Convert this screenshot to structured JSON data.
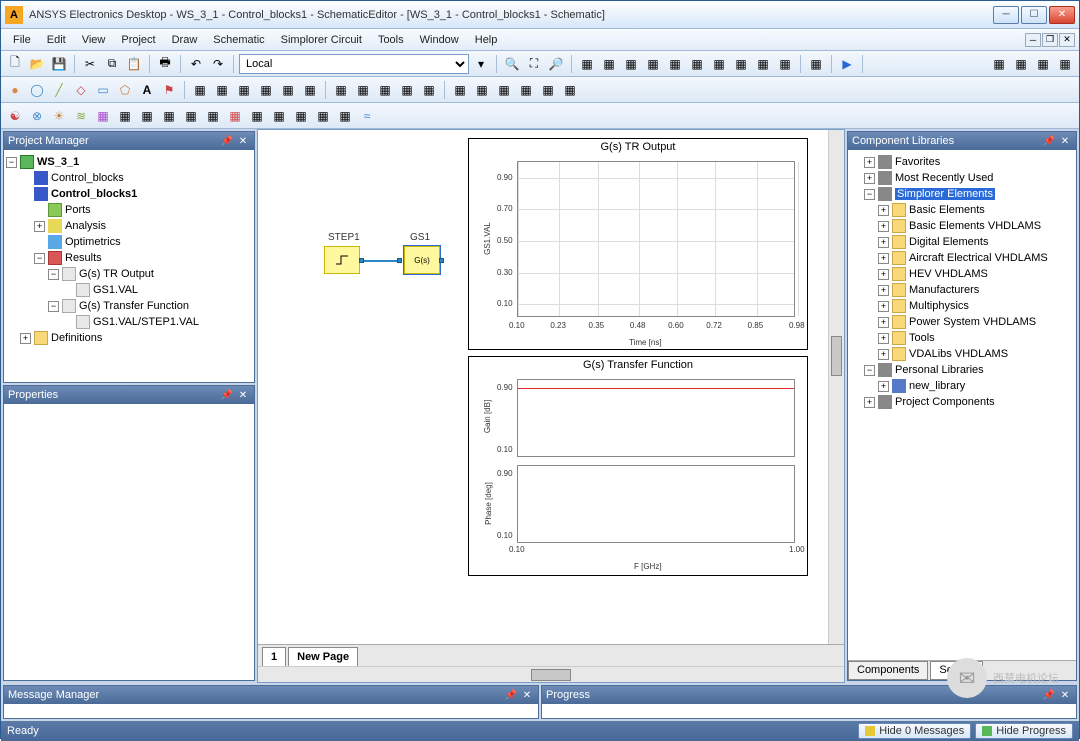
{
  "title": "ANSYS Electronics Desktop - WS_3_1 - Control_blocks1 - SchematicEditor - [WS_3_1 - Control_blocks1 - Schematic]",
  "menu": [
    "File",
    "Edit",
    "View",
    "Project",
    "Draw",
    "Schematic",
    "Simplorer Circuit",
    "Tools",
    "Window",
    "Help"
  ],
  "toolbar1": {
    "combo": "Local"
  },
  "panels": {
    "projectManager": "Project Manager",
    "properties": "Properties",
    "componentLibraries": "Component Libraries",
    "messageManager": "Message Manager",
    "progress": "Progress"
  },
  "tree": {
    "root": "WS_3_1",
    "items": [
      {
        "label": "Control_blocks",
        "icon": "i-blk"
      },
      {
        "label": "Control_blocks1",
        "icon": "i-blk",
        "bold": true
      },
      {
        "label": "Ports",
        "icon": "i-port",
        "indent": 2
      },
      {
        "label": "Analysis",
        "icon": "i-ana",
        "indent": 2,
        "exp": "+"
      },
      {
        "label": "Optimetrics",
        "icon": "i-opt",
        "indent": 2
      },
      {
        "label": "Results",
        "icon": "i-res",
        "indent": 2,
        "exp": "-"
      },
      {
        "label": "G(s) TR Output",
        "icon": "i-chart",
        "indent": 3,
        "exp": "-"
      },
      {
        "label": "GS1.VAL",
        "icon": "i-chart",
        "indent": 4
      },
      {
        "label": "G(s) Transfer Function",
        "icon": "i-chart",
        "indent": 3,
        "exp": "-"
      },
      {
        "label": "GS1.VAL/STEP1.VAL",
        "icon": "i-chart",
        "indent": 4
      },
      {
        "label": "Definitions",
        "icon": "i-def",
        "indent": 1,
        "exp": "+"
      }
    ]
  },
  "schematic": {
    "blocks": [
      {
        "name": "STEP1"
      },
      {
        "name": "GS1",
        "text": "G(s)"
      }
    ],
    "tabs": {
      "current": "1",
      "new": "New Page"
    }
  },
  "chart_data": [
    {
      "type": "line",
      "title": "G(s) TR Output",
      "xlabel": "Time [ns]",
      "ylabel": "GS1.VAL",
      "x": [
        0.1,
        0.23,
        0.35,
        0.48,
        0.6,
        0.72,
        0.85,
        0.98
      ],
      "xticks": [
        0.1,
        0.23,
        0.35,
        0.48,
        0.6,
        0.72,
        0.85,
        0.98
      ],
      "yticks": [
        0.1,
        0.3,
        0.5,
        0.7,
        0.9
      ],
      "xlim": [
        0.1,
        0.98
      ],
      "ylim": [
        0.0,
        1.0
      ]
    },
    {
      "type": "line",
      "title": "G(s) Transfer Function",
      "xlabel": "F [GHz]",
      "subplots": [
        {
          "ylabel": "Gain [dB]",
          "yticks": [
            0.1,
            0.9
          ],
          "flatline": 0.9,
          "xlim": [
            0.1,
            1.0
          ]
        },
        {
          "ylabel": "Phase [deg]",
          "yticks": [
            0.1,
            0.9
          ],
          "xlim": [
            0.1,
            1.0
          ]
        }
      ],
      "xticks": [
        0.1,
        1.0
      ]
    }
  ],
  "libraries": {
    "top": [
      {
        "label": "Favorites",
        "exp": "+",
        "icon": "i-fav"
      },
      {
        "label": "Most Recently Used",
        "exp": "+",
        "icon": "i-fav"
      }
    ],
    "simplorer": {
      "label": "Simplorer Elements",
      "exp": "-",
      "selected": true,
      "children": [
        "Basic Elements",
        "Basic Elements VHDLAMS",
        "Digital Elements",
        "Aircraft Electrical VHDLAMS",
        "HEV VHDLAMS",
        "Manufacturers",
        "Multiphysics",
        "Power System VHDLAMS",
        "Tools",
        "VDALibs VHDLAMS"
      ]
    },
    "personal": {
      "label": "Personal Libraries",
      "exp": "-",
      "children": [
        {
          "label": "new_library",
          "icon": "i-libp"
        }
      ]
    },
    "projcomp": {
      "label": "Project Components",
      "exp": "+"
    },
    "tabs": [
      "Components",
      "Search"
    ]
  },
  "status": {
    "ready": "Ready",
    "hideMsg": "Hide 0 Messages",
    "hideProg": "Hide Progress"
  },
  "watermark": "西莫电机论坛"
}
